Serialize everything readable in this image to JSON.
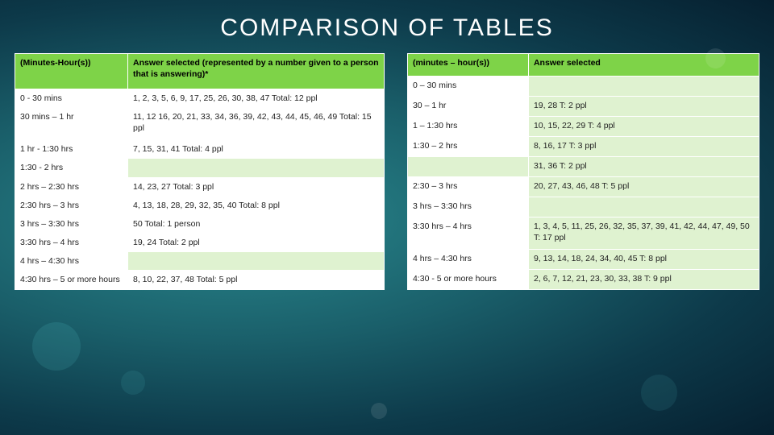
{
  "title": "COMPARISON OF TABLES",
  "left": {
    "h1": "(Minutes-Hour(s))",
    "h2": "Answer selected (represented by a number given to a person that is answering)*",
    "rows": [
      {
        "range": "0 - 30 mins",
        "answer": "1, 2, 3, 5, 6, 9, 17, 25, 26, 30, 38, 47    Total: 12 ppl"
      },
      {
        "range": "30 mins – 1 hr",
        "answer": "11, 12 16, 20, 21, 33, 34, 36, 39, 42, 43, 44, 45, 46, 49                         Total: 15 ppl"
      },
      {
        "range": "1 hr - 1:30 hrs",
        "answer": "7, 15, 31, 41                         Total: 4 ppl"
      },
      {
        "range": "1:30 - 2 hrs",
        "answer": ""
      },
      {
        "range": "2 hrs – 2:30 hrs",
        "answer": "14, 23, 27                             Total: 3 ppl"
      },
      {
        "range": "2:30 hrs – 3 hrs",
        "answer": "4, 13, 18, 28, 29, 32, 35, 40     Total: 8 ppl"
      },
      {
        "range": "3 hrs – 3:30 hrs",
        "answer": "50                                         Total: 1 person"
      },
      {
        "range": "3:30 hrs – 4 hrs",
        "answer": "19, 24                                    Total: 2 ppl"
      },
      {
        "range": "4 hrs – 4:30 hrs",
        "answer": ""
      },
      {
        "range": "4:30 hrs – 5 or more hours",
        "answer": "8, 10, 22, 37, 48                  Total: 5 ppl"
      }
    ]
  },
  "right": {
    "h1": "(minutes – hour(s))",
    "h2": "Answer selected",
    "rows": [
      {
        "range": "0 – 30 mins",
        "answer": ""
      },
      {
        "range": "30 – 1 hr",
        "answer": "19, 28                                  T: 2 ppl"
      },
      {
        "range": "1 – 1:30 hrs",
        "answer": "10, 15, 22, 29                      T: 4 ppl"
      },
      {
        "range": "1:30 – 2 hrs",
        "answer": "8, 16, 17                              T: 3 ppl"
      },
      {
        "range": "",
        "answer": "31, 36                                  T: 2 ppl"
      },
      {
        "range": "2:30 – 3 hrs",
        "answer": "20, 27, 43, 46, 48                 T: 5 ppl"
      },
      {
        "range": "3 hrs – 3:30 hrs",
        "answer": ""
      },
      {
        "range": "3:30 hrs – 4 hrs",
        "answer": "1, 3, 4, 5, 11, 25, 26, 32, 35, 37, 39, 41, 42, 44, 47, 49, 50                 T: 17 ppl"
      },
      {
        "range": "4 hrs – 4:30 hrs",
        "answer": "9, 13, 14, 18, 24, 34, 40, 45   T: 8 ppl"
      },
      {
        "range": "4:30 - 5 or more hours",
        "answer": "2, 6, 7, 12, 21, 23, 30, 33, 38   T: 9 ppl"
      }
    ]
  }
}
